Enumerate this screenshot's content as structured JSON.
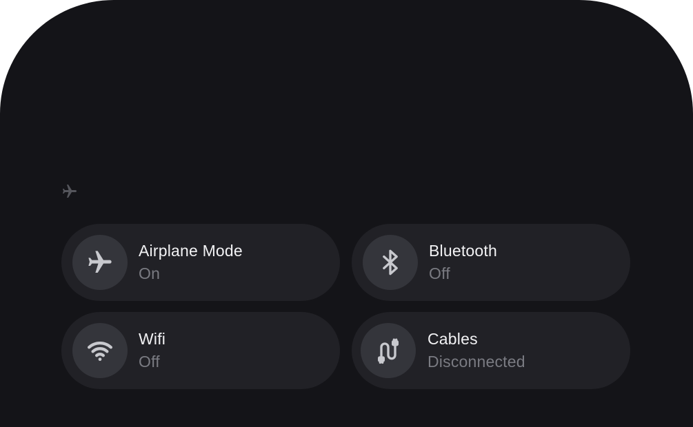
{
  "status_bar": {
    "icon": "airplane-icon"
  },
  "tiles": [
    {
      "id": "airplane",
      "icon": "airplane-icon",
      "title": "Airplane Mode",
      "status": "On"
    },
    {
      "id": "bluetooth",
      "icon": "bluetooth-icon",
      "title": "Bluetooth",
      "status": "Off"
    },
    {
      "id": "wifi",
      "icon": "wifi-icon",
      "title": "Wifi",
      "status": "Off"
    },
    {
      "id": "cables",
      "icon": "cable-icon",
      "title": "Cables",
      "status": "Disconnected"
    }
  ],
  "colors": {
    "background": "#141418",
    "tile": "#212126",
    "icon_circle": "#34353b",
    "title_text": "#f2f2f4",
    "status_text": "#7a7b82"
  }
}
